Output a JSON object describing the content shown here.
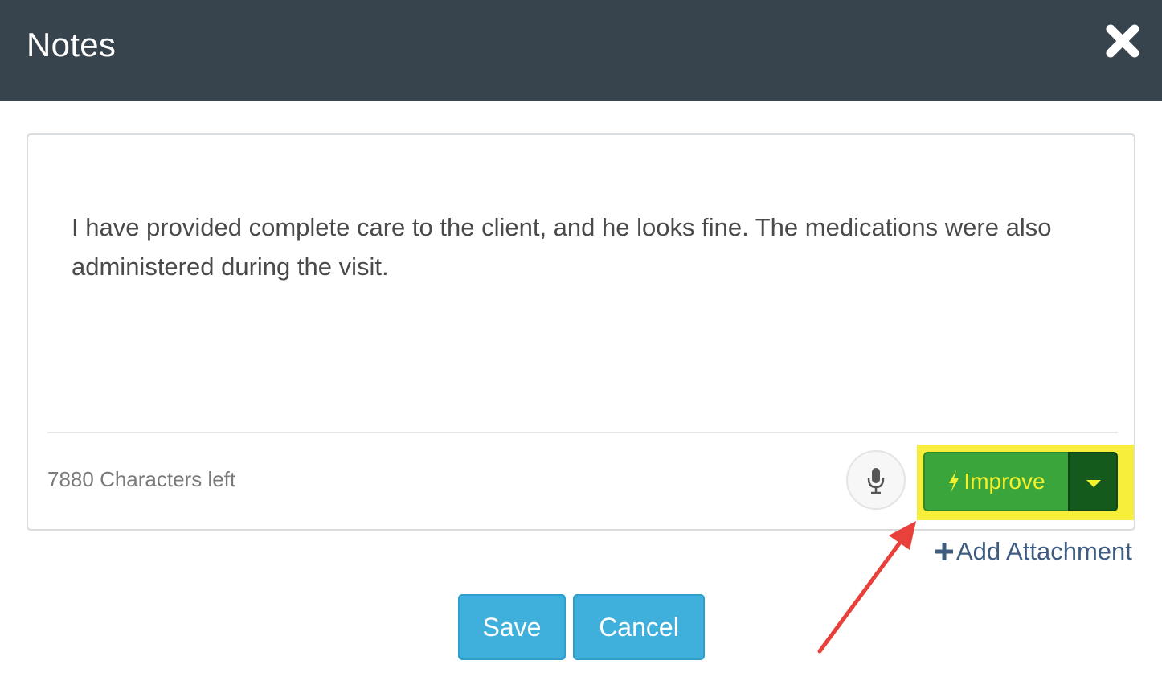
{
  "header": {
    "title": "Notes"
  },
  "notes": {
    "text": "I have provided complete care to the client, and he looks fine. The medications were also administered during the visit.",
    "chars_left": "7880 Characters left"
  },
  "toolbar": {
    "improve_label": "Improve",
    "add_attachment_label": "Add Attachment"
  },
  "footer": {
    "save_label": "Save",
    "cancel_label": "Cancel"
  },
  "colors": {
    "header_bg": "#38444d",
    "improve_green": "#3aa53a",
    "improve_dark": "#145a1c",
    "improve_text": "#f5f02c",
    "highlight": "#f7ee3b",
    "primary_blue": "#3fb0dc",
    "link_blue": "#3e5b80",
    "arrow_red": "#e8413c"
  },
  "icons": {
    "close": "close-icon",
    "mic": "microphone-icon",
    "bolt": "lightning-bolt-icon",
    "caret": "caret-down-icon",
    "plus": "plus-icon"
  }
}
